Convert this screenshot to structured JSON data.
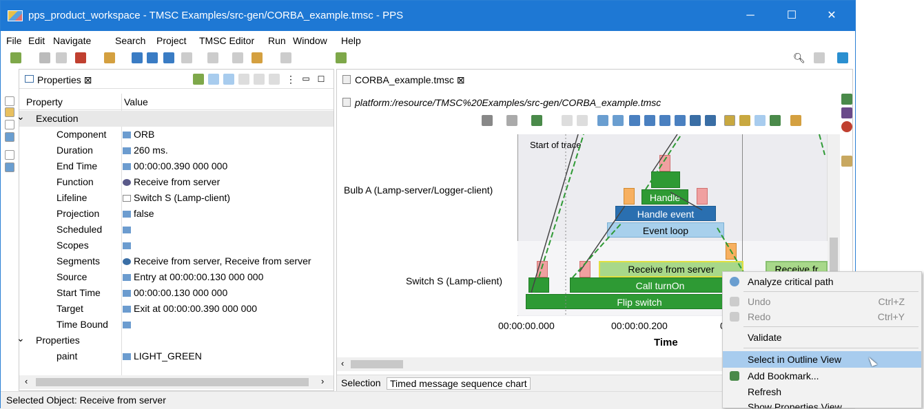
{
  "window": {
    "title": "pps_product_workspace - TMSC Examples/src-gen/CORBA_example.tmsc - PPS",
    "min": "─",
    "max": "☐",
    "close": "✕"
  },
  "menu": [
    "File",
    "Edit",
    "Navigate",
    "Search",
    "Project",
    "TMSC Editor",
    "Run",
    "Window",
    "Help"
  ],
  "properties": {
    "tab": "Properties ⊠",
    "col_property": "Property",
    "col_value": "Value",
    "rows": [
      {
        "k": "Execution",
        "v": "",
        "group": true
      },
      {
        "k": "Component",
        "v": "ORB"
      },
      {
        "k": "Duration",
        "v": "260 ms."
      },
      {
        "k": "End Time",
        "v": "00:00:00.390 000 000"
      },
      {
        "k": "Function",
        "v": "Receive from server"
      },
      {
        "k": "Lifeline",
        "v": "Switch S (Lamp-client)"
      },
      {
        "k": "Projection",
        "v": "false"
      },
      {
        "k": "Scheduled",
        "v": ""
      },
      {
        "k": "Scopes",
        "v": ""
      },
      {
        "k": "Segments",
        "v": "Receive from server, Receive from server"
      },
      {
        "k": "Source",
        "v": "Entry at 00:00:00.130 000 000"
      },
      {
        "k": "Start Time",
        "v": "00:00:00.130 000 000"
      },
      {
        "k": "Target",
        "v": "Exit at 00:00:00.390 000 000"
      },
      {
        "k": "Time Bound",
        "v": ""
      },
      {
        "k": "Properties",
        "v": "",
        "group": true
      },
      {
        "k": "paint",
        "v": "LIGHT_GREEN"
      }
    ]
  },
  "status": "Selected Object: Receive from server",
  "editor": {
    "tab": "CORBA_example.tmsc ⊠",
    "path": "platform:/resource/TMSC%20Examples/src-gen/CORBA_example.tmsc",
    "start_of_trace": "Start of trace",
    "lane1": "Bulb A (Lamp-server/Logger-client)",
    "lane2": "Switch S (Lamp-client)",
    "bars": {
      "handle": "Handle",
      "handle_event": "Handle event",
      "event_loop": "Event loop",
      "receive": "Receive from server",
      "receive2": "Receive fr",
      "call": "Call turnOn",
      "flip": "Flip switch"
    },
    "ticks": [
      "00:00:00.000",
      "00:00:00.200",
      "0"
    ],
    "xlabel": "Time",
    "tab_selection": "Selection",
    "tab_chart": "Timed message sequence chart"
  },
  "context_menu": {
    "analyze": "Analyze critical path",
    "undo": "Undo",
    "undo_sc": "Ctrl+Z",
    "redo": "Redo",
    "redo_sc": "Ctrl+Y",
    "validate": "Validate",
    "select_outline": "Select in Outline View",
    "add_bookmark": "Add Bookmark...",
    "refresh": "Refresh",
    "show_props": "Show Properties View"
  }
}
